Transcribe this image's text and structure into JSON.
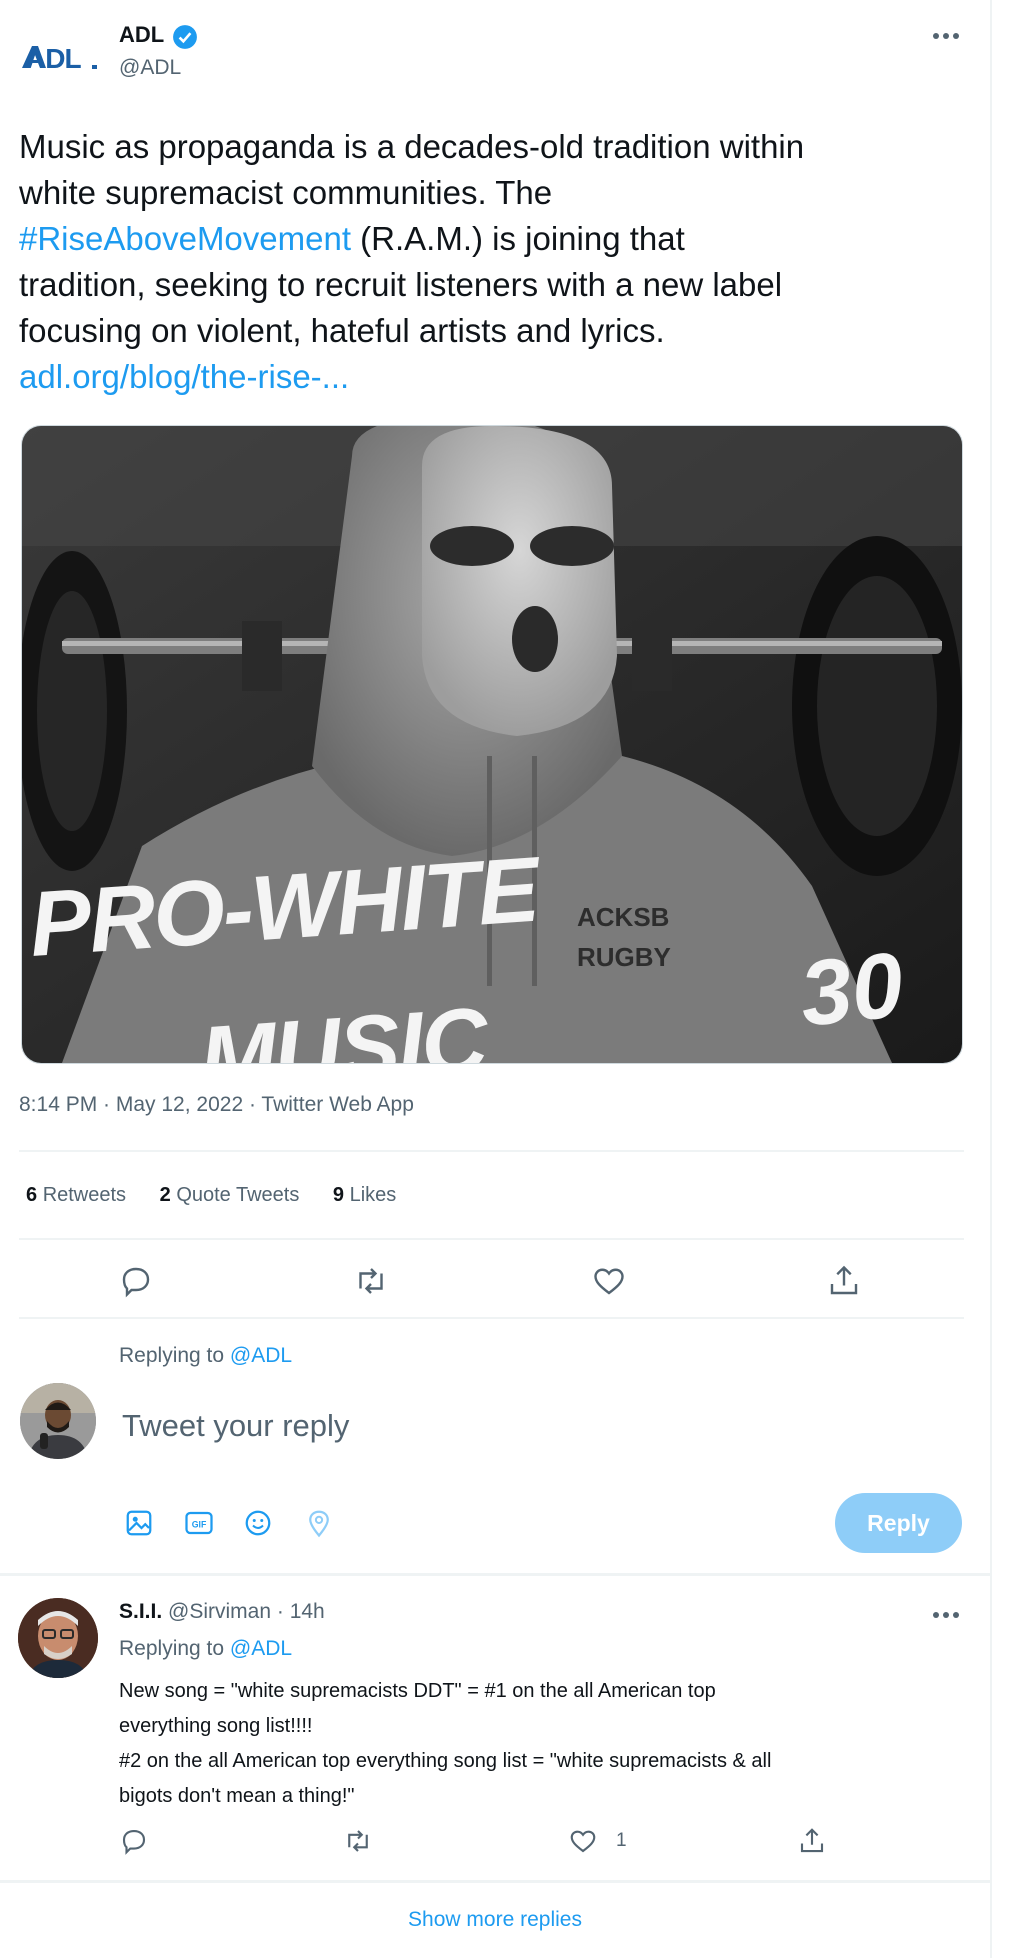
{
  "tweet": {
    "author": {
      "name": "ADL",
      "handle": "@ADL",
      "logo_text": "ADL"
    },
    "text_lines": [
      "Music as propaganda is a decades-old tradition within",
      "white supremacist communities. The"
    ],
    "hashtag": "#RiseAboveMovement",
    "after_hashtag": " (R.A.M.) is joining that",
    "text_lines_2": [
      "tradition, seeking to recruit listeners with a new label",
      "focusing on violent, hateful artists and lyrics."
    ],
    "link": "adl.org/blog/the-rise-...",
    "image": {
      "overlay_text": "PRO-WHITE",
      "overlay_text_2": "MUSIC",
      "number": "30",
      "shirt_text_1": "ACKSB",
      "shirt_text_2": "RUGBY"
    },
    "timestamp": "8:14 PM · May 12, 2022 · Twitter Web App",
    "stats": {
      "retweets_count": "6",
      "retweets_label": "Retweets",
      "quotes_count": "2",
      "quotes_label": "Quote Tweets",
      "likes_count": "9",
      "likes_label": "Likes"
    }
  },
  "compose": {
    "replying_prefix": "Replying to",
    "replying_handle": "@ADL",
    "placeholder": "Tweet your reply",
    "reply_button": "Reply"
  },
  "reply": {
    "name": "S.I.I.",
    "handle_time": "@Sirviman · 14h",
    "replying_prefix": "Replying to",
    "replying_handle": "@ADL",
    "lines": [
      "New song = \"white supremacists DDT\"  = #1 on the all American top",
      "everything song list!!!!",
      "#2 on the all American top everything song list = \"white supremacists & all",
      "bigots don't mean a thing!\""
    ],
    "like_count": "1"
  },
  "show_more": "Show more replies",
  "colors": {
    "accent": "#1d9bf0",
    "reply_button": "#8ecdf8",
    "secondary_text": "#536471"
  }
}
